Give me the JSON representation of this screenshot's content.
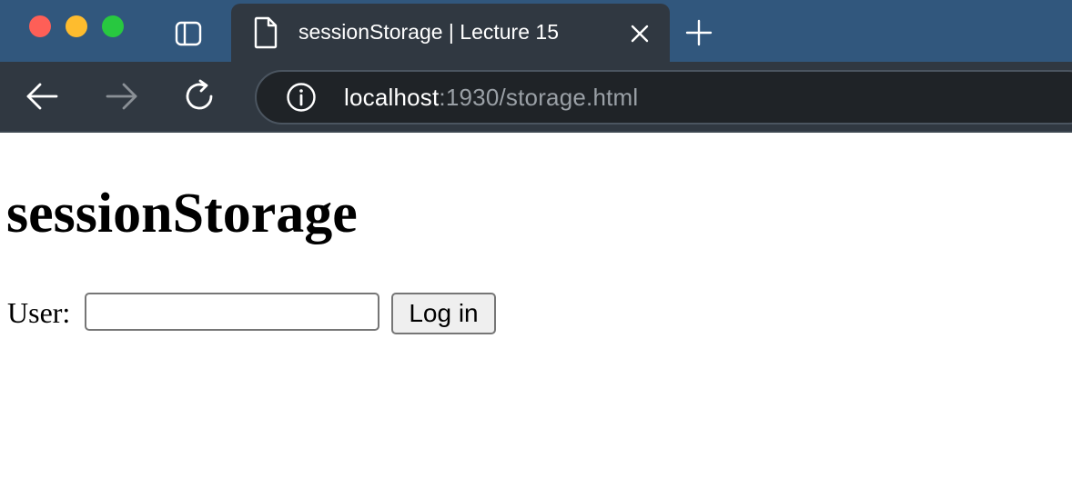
{
  "browser": {
    "tab": {
      "title": "sessionStorage | Lecture 15"
    },
    "address_bar": {
      "host": "localhost",
      "rest": ":1930/storage.html"
    },
    "icons": {
      "traffic_close": "close-window-icon",
      "traffic_minimize": "minimize-window-icon",
      "traffic_maximize": "maximize-window-icon",
      "tab_overview": "tab-overview-icon",
      "document": "document-icon",
      "tab_close": "close-icon",
      "new_tab": "plus-icon",
      "back": "back-arrow-icon",
      "forward": "forward-arrow-icon",
      "reload": "reload-icon",
      "site_info": "info-icon"
    },
    "colors": {
      "tab_strip": "#31577d",
      "toolbar": "#303841",
      "omnibox": "#1f2327"
    }
  },
  "page": {
    "heading": "sessionStorage",
    "form": {
      "user_label": "User:",
      "user_value": "",
      "login_label": "Log in"
    }
  }
}
